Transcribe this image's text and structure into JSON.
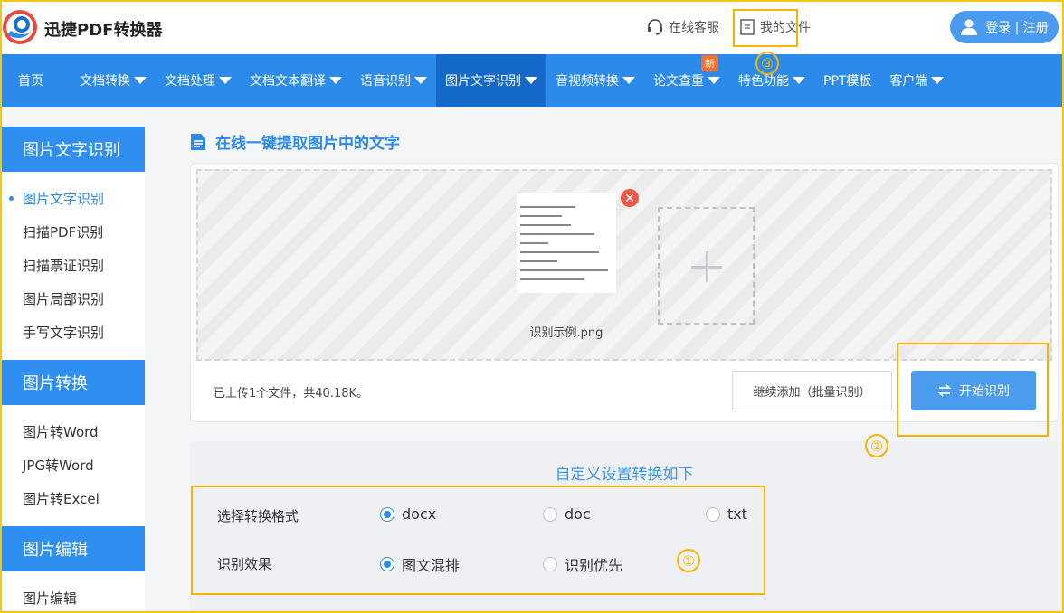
{
  "header": {
    "brand": "迅捷PDF转换器",
    "service_label": "在线客服",
    "my_files_label": "我的文件",
    "login_label": "登录 | 注册"
  },
  "nav": {
    "items": [
      {
        "label": "首页",
        "dropdown": false
      },
      {
        "label": "文档转换",
        "dropdown": true
      },
      {
        "label": "文档处理",
        "dropdown": true
      },
      {
        "label": "文档文本翻译",
        "dropdown": true
      },
      {
        "label": "语音识别",
        "dropdown": true
      },
      {
        "label": "图片文字识别",
        "dropdown": true,
        "active": true
      },
      {
        "label": "音视频转换",
        "dropdown": true
      },
      {
        "label": "论文查重",
        "dropdown": true
      },
      {
        "label": "特色功能",
        "dropdown": true
      },
      {
        "label": "PPT模板",
        "dropdown": false
      },
      {
        "label": "客户端",
        "dropdown": true
      }
    ],
    "new_badge": "新"
  },
  "sidebar": {
    "sections": [
      {
        "title": "图片文字识别",
        "items": [
          "图片文字识别",
          "扫描PDF识别",
          "扫描票证识别",
          "图片局部识别",
          "手写文字识别"
        ]
      },
      {
        "title": "图片转换",
        "items": [
          "图片转Word",
          "JPG转Word",
          "图片转Excel"
        ]
      },
      {
        "title": "图片编辑",
        "items": [
          "图片编辑"
        ]
      }
    ]
  },
  "main": {
    "title": "在线一键提取图片中的文字",
    "file_name": "识别示例.png",
    "status": "已上传1个文件，共40.18K。",
    "add_more_label": "继续添加（批量识别）",
    "start_label": "开始识别"
  },
  "settings": {
    "title": "自定义设置转换如下",
    "format_label": "选择转换格式",
    "formats": [
      "docx",
      "doc",
      "txt"
    ],
    "format_selected": "docx",
    "effect_label": "识别效果",
    "effects": [
      "图文混排",
      "识别优先"
    ],
    "effect_selected": "图文混排"
  },
  "annotations": {
    "one": "①",
    "two": "②",
    "three": "③"
  },
  "colors": {
    "primary": "#2c8bea",
    "nav_active": "#1469c9",
    "annotation": "#f5b400",
    "remove": "#ec5748"
  }
}
